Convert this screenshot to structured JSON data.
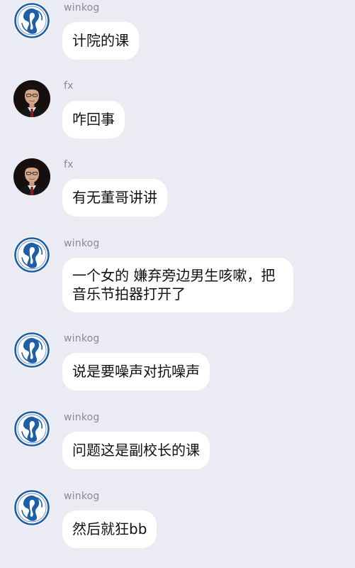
{
  "conversation": {
    "messages": [
      {
        "sender": "winkog",
        "avatar": "winkog-logo-icon",
        "text": "计院的课"
      },
      {
        "sender": "fx",
        "avatar": "fx-photo-avatar",
        "text": "咋回事"
      },
      {
        "sender": "fx",
        "avatar": "fx-photo-avatar",
        "text": "有无董哥讲讲"
      },
      {
        "sender": "winkog",
        "avatar": "winkog-logo-icon",
        "text": "一个女的 嫌弃旁边男生咳嗽，把音乐节拍器打开了"
      },
      {
        "sender": "winkog",
        "avatar": "winkog-logo-icon",
        "text": "说是要噪声对抗噪声"
      },
      {
        "sender": "winkog",
        "avatar": "winkog-logo-icon",
        "text": "问题这是副校长的课"
      },
      {
        "sender": "winkog",
        "avatar": "winkog-logo-icon",
        "text": "然后就狂bb"
      }
    ]
  },
  "colors": {
    "background": "#ebebf3",
    "bubble": "#ffffff",
    "sender_name": "#8a8a93",
    "logo_blue": "#1f5fa8"
  }
}
